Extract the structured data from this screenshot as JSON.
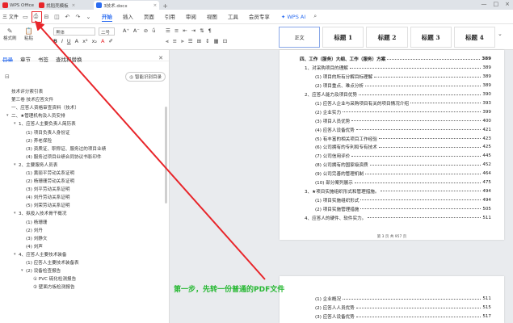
{
  "titlebar": {
    "tabs": [
      {
        "label": "WPS Office",
        "color": "#e8252a",
        "active": false
      },
      {
        "label": "找稻壳模板",
        "color": "#e8252a",
        "active": false
      },
      {
        "label": "3技术.docx",
        "color": "#2b6cf0",
        "active": true
      }
    ],
    "new_tab": "+"
  },
  "menubar": {
    "file": "三 文件",
    "menus": [
      "开始",
      "插入",
      "页面",
      "引用",
      "审阅",
      "视图",
      "工具",
      "会员专享"
    ],
    "active_menu": "开始",
    "wps_ai": "WPS AI"
  },
  "ribbon": {
    "format_painter": "格式刷",
    "paste": "粘贴",
    "font_name": "黑体",
    "font_size": "二号",
    "styles": [
      "正文",
      "标题 1",
      "标题 2",
      "标题 3",
      "标题 4"
    ]
  },
  "nav": {
    "tabs": [
      "目录",
      "章节",
      "书签",
      "查找和替换"
    ],
    "active_tab": "目录",
    "smart_button": "智能识别目录",
    "items": [
      {
        "text": "技术评分索引表",
        "indent": 0,
        "arrow": ""
      },
      {
        "text": "第三卷    技术应答文件",
        "indent": 0,
        "arrow": ""
      },
      {
        "text": "一、应答人资格审查资料（技术）",
        "indent": 0,
        "arrow": ""
      },
      {
        "text": "二、★管理机构及人员安排",
        "indent": 0,
        "arrow": "▾"
      },
      {
        "text": "1、应答人主要负责人简历表",
        "indent": 1,
        "arrow": "▾"
      },
      {
        "text": "(1) 项目负责人身份证",
        "indent": 2,
        "arrow": ""
      },
      {
        "text": "(2) 养老保险",
        "indent": 2,
        "arrow": ""
      },
      {
        "text": "(3) 资质证、职称证、服务过的项目业绩",
        "indent": 2,
        "arrow": ""
      },
      {
        "text": "(4) 服务过项目业绩合同协议书影印件",
        "indent": 2,
        "arrow": ""
      },
      {
        "text": "2、主要服务人员表",
        "indent": 1,
        "arrow": "▾"
      },
      {
        "text": "(1) 黄丽平劳动关系证明",
        "indent": 2,
        "arrow": ""
      },
      {
        "text": "(2) 杨珊珊劳动关系证明",
        "indent": 2,
        "arrow": ""
      },
      {
        "text": "(3) 刘平劳动关系证明",
        "indent": 2,
        "arrow": ""
      },
      {
        "text": "(4) 刘丹劳动关系证明",
        "indent": 2,
        "arrow": ""
      },
      {
        "text": "(5) 刘荣劳动关系证明",
        "indent": 2,
        "arrow": ""
      },
      {
        "text": "3、拟投入技术骨干概况",
        "indent": 1,
        "arrow": "▾"
      },
      {
        "text": "(1) 杨珊珊",
        "indent": 2,
        "arrow": ""
      },
      {
        "text": "(2) 刘丹",
        "indent": 2,
        "arrow": ""
      },
      {
        "text": "(3) 刘静文",
        "indent": 2,
        "arrow": ""
      },
      {
        "text": "(4) 刘声",
        "indent": 2,
        "arrow": ""
      },
      {
        "text": "4、应答人主要技术装备",
        "indent": 1,
        "arrow": "▾"
      },
      {
        "text": "(1) 应答人主要技术装备表",
        "indent": 2,
        "arrow": ""
      },
      {
        "text": "(2) 设备检查报告",
        "indent": 2,
        "arrow": "▾"
      },
      {
        "text": "① PVC 硫化检测报告",
        "indent": 3,
        "arrow": ""
      },
      {
        "text": "② 壁面方板检测报告",
        "indent": 3,
        "arrow": ""
      }
    ]
  },
  "document": {
    "page1_lines": [
      {
        "text": "四、工作（服务）大纲、工作（服务）方案",
        "page": "389",
        "indent": 0,
        "bold": true
      },
      {
        "text": "1、对采购项目的理解",
        "page": "389",
        "indent": 1,
        "bold": false
      },
      {
        "text": "(1)  项目的所有分解目标理解",
        "page": "389",
        "indent": 2,
        "bold": false
      },
      {
        "text": "(2)  项目重点、难点分析",
        "page": "389",
        "indent": 2,
        "bold": false
      },
      {
        "text": "2、应答人能力及项目优势",
        "page": "390",
        "indent": 1,
        "bold": false
      },
      {
        "text": "(1)  应答人企业与采购项目有关的项目情况介绍",
        "page": "393",
        "indent": 2,
        "bold": false
      },
      {
        "text": "(2)  企业实力",
        "page": "399",
        "indent": 2,
        "bold": false
      },
      {
        "text": "(3)  项目人员优势",
        "page": "400",
        "indent": 2,
        "bold": false
      },
      {
        "text": "(4)  应答人设备优势",
        "page": "421",
        "indent": 2,
        "bold": false
      },
      {
        "text": "(5)  有丰富的相关项目工作经验",
        "page": "423",
        "indent": 2,
        "bold": false
      },
      {
        "text": "(6)  公司拥有的专利和专有技术",
        "page": "425",
        "indent": 2,
        "bold": false
      },
      {
        "text": "(7)  公司信用评价",
        "page": "445",
        "indent": 2,
        "bold": false
      },
      {
        "text": "(8)  公司拥有的国家级资质",
        "page": "452",
        "indent": 2,
        "bold": false
      },
      {
        "text": "(9)  公司完善的管理机制",
        "page": "464",
        "indent": 2,
        "bold": false
      },
      {
        "text": "(10) 部分案列展示",
        "page": "475",
        "indent": 2,
        "bold": false
      },
      {
        "text": "3、★项目实施组织形式和管理措施。",
        "page": "494",
        "indent": 1,
        "bold": false
      },
      {
        "text": "(1)  项目实施组织形式",
        "page": "494",
        "indent": 2,
        "bold": false
      },
      {
        "text": "(2)  项目实施管理措施",
        "page": "505",
        "indent": 2,
        "bold": false
      },
      {
        "text": "4、应答人的硬件、软件实力。",
        "page": "511",
        "indent": 1,
        "bold": false
      }
    ],
    "page1_footer": "第 3 页 共 957 页",
    "page2_lines": [
      {
        "text": "(1)  企业概况",
        "page": "511",
        "indent": 2
      },
      {
        "text": "(2)  应答人人员优势",
        "page": "515",
        "indent": 2
      },
      {
        "text": "(3)  应答人设备优势",
        "page": "517",
        "indent": 2
      }
    ]
  },
  "annotation": "第一步，先转一份普通的PDF文件",
  "colors": {
    "accent": "#2b6cf0",
    "annotation": "#27b833",
    "arrow": "#e8252a"
  }
}
